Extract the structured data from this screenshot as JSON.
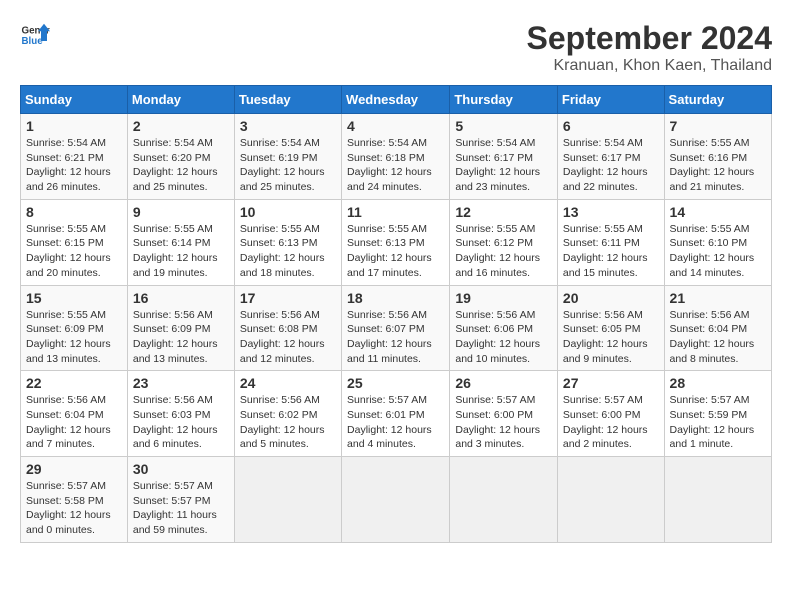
{
  "header": {
    "logo_general": "General",
    "logo_blue": "Blue",
    "title": "September 2024",
    "subtitle": "Kranuan, Khon Kaen, Thailand"
  },
  "days_of_week": [
    "Sunday",
    "Monday",
    "Tuesday",
    "Wednesday",
    "Thursday",
    "Friday",
    "Saturday"
  ],
  "weeks": [
    [
      {
        "day": "1",
        "info": "Sunrise: 5:54 AM\nSunset: 6:21 PM\nDaylight: 12 hours\nand 26 minutes."
      },
      {
        "day": "2",
        "info": "Sunrise: 5:54 AM\nSunset: 6:20 PM\nDaylight: 12 hours\nand 25 minutes."
      },
      {
        "day": "3",
        "info": "Sunrise: 5:54 AM\nSunset: 6:19 PM\nDaylight: 12 hours\nand 25 minutes."
      },
      {
        "day": "4",
        "info": "Sunrise: 5:54 AM\nSunset: 6:18 PM\nDaylight: 12 hours\nand 24 minutes."
      },
      {
        "day": "5",
        "info": "Sunrise: 5:54 AM\nSunset: 6:17 PM\nDaylight: 12 hours\nand 23 minutes."
      },
      {
        "day": "6",
        "info": "Sunrise: 5:54 AM\nSunset: 6:17 PM\nDaylight: 12 hours\nand 22 minutes."
      },
      {
        "day": "7",
        "info": "Sunrise: 5:55 AM\nSunset: 6:16 PM\nDaylight: 12 hours\nand 21 minutes."
      }
    ],
    [
      {
        "day": "8",
        "info": "Sunrise: 5:55 AM\nSunset: 6:15 PM\nDaylight: 12 hours\nand 20 minutes."
      },
      {
        "day": "9",
        "info": "Sunrise: 5:55 AM\nSunset: 6:14 PM\nDaylight: 12 hours\nand 19 minutes."
      },
      {
        "day": "10",
        "info": "Sunrise: 5:55 AM\nSunset: 6:13 PM\nDaylight: 12 hours\nand 18 minutes."
      },
      {
        "day": "11",
        "info": "Sunrise: 5:55 AM\nSunset: 6:13 PM\nDaylight: 12 hours\nand 17 minutes."
      },
      {
        "day": "12",
        "info": "Sunrise: 5:55 AM\nSunset: 6:12 PM\nDaylight: 12 hours\nand 16 minutes."
      },
      {
        "day": "13",
        "info": "Sunrise: 5:55 AM\nSunset: 6:11 PM\nDaylight: 12 hours\nand 15 minutes."
      },
      {
        "day": "14",
        "info": "Sunrise: 5:55 AM\nSunset: 6:10 PM\nDaylight: 12 hours\nand 14 minutes."
      }
    ],
    [
      {
        "day": "15",
        "info": "Sunrise: 5:55 AM\nSunset: 6:09 PM\nDaylight: 12 hours\nand 13 minutes."
      },
      {
        "day": "16",
        "info": "Sunrise: 5:56 AM\nSunset: 6:09 PM\nDaylight: 12 hours\nand 13 minutes."
      },
      {
        "day": "17",
        "info": "Sunrise: 5:56 AM\nSunset: 6:08 PM\nDaylight: 12 hours\nand 12 minutes."
      },
      {
        "day": "18",
        "info": "Sunrise: 5:56 AM\nSunset: 6:07 PM\nDaylight: 12 hours\nand 11 minutes."
      },
      {
        "day": "19",
        "info": "Sunrise: 5:56 AM\nSunset: 6:06 PM\nDaylight: 12 hours\nand 10 minutes."
      },
      {
        "day": "20",
        "info": "Sunrise: 5:56 AM\nSunset: 6:05 PM\nDaylight: 12 hours\nand 9 minutes."
      },
      {
        "day": "21",
        "info": "Sunrise: 5:56 AM\nSunset: 6:04 PM\nDaylight: 12 hours\nand 8 minutes."
      }
    ],
    [
      {
        "day": "22",
        "info": "Sunrise: 5:56 AM\nSunset: 6:04 PM\nDaylight: 12 hours\nand 7 minutes."
      },
      {
        "day": "23",
        "info": "Sunrise: 5:56 AM\nSunset: 6:03 PM\nDaylight: 12 hours\nand 6 minutes."
      },
      {
        "day": "24",
        "info": "Sunrise: 5:56 AM\nSunset: 6:02 PM\nDaylight: 12 hours\nand 5 minutes."
      },
      {
        "day": "25",
        "info": "Sunrise: 5:57 AM\nSunset: 6:01 PM\nDaylight: 12 hours\nand 4 minutes."
      },
      {
        "day": "26",
        "info": "Sunrise: 5:57 AM\nSunset: 6:00 PM\nDaylight: 12 hours\nand 3 minutes."
      },
      {
        "day": "27",
        "info": "Sunrise: 5:57 AM\nSunset: 6:00 PM\nDaylight: 12 hours\nand 2 minutes."
      },
      {
        "day": "28",
        "info": "Sunrise: 5:57 AM\nSunset: 5:59 PM\nDaylight: 12 hours\nand 1 minute."
      }
    ],
    [
      {
        "day": "29",
        "info": "Sunrise: 5:57 AM\nSunset: 5:58 PM\nDaylight: 12 hours\nand 0 minutes."
      },
      {
        "day": "30",
        "info": "Sunrise: 5:57 AM\nSunset: 5:57 PM\nDaylight: 11 hours\nand 59 minutes."
      },
      {
        "day": "",
        "info": ""
      },
      {
        "day": "",
        "info": ""
      },
      {
        "day": "",
        "info": ""
      },
      {
        "day": "",
        "info": ""
      },
      {
        "day": "",
        "info": ""
      }
    ]
  ]
}
